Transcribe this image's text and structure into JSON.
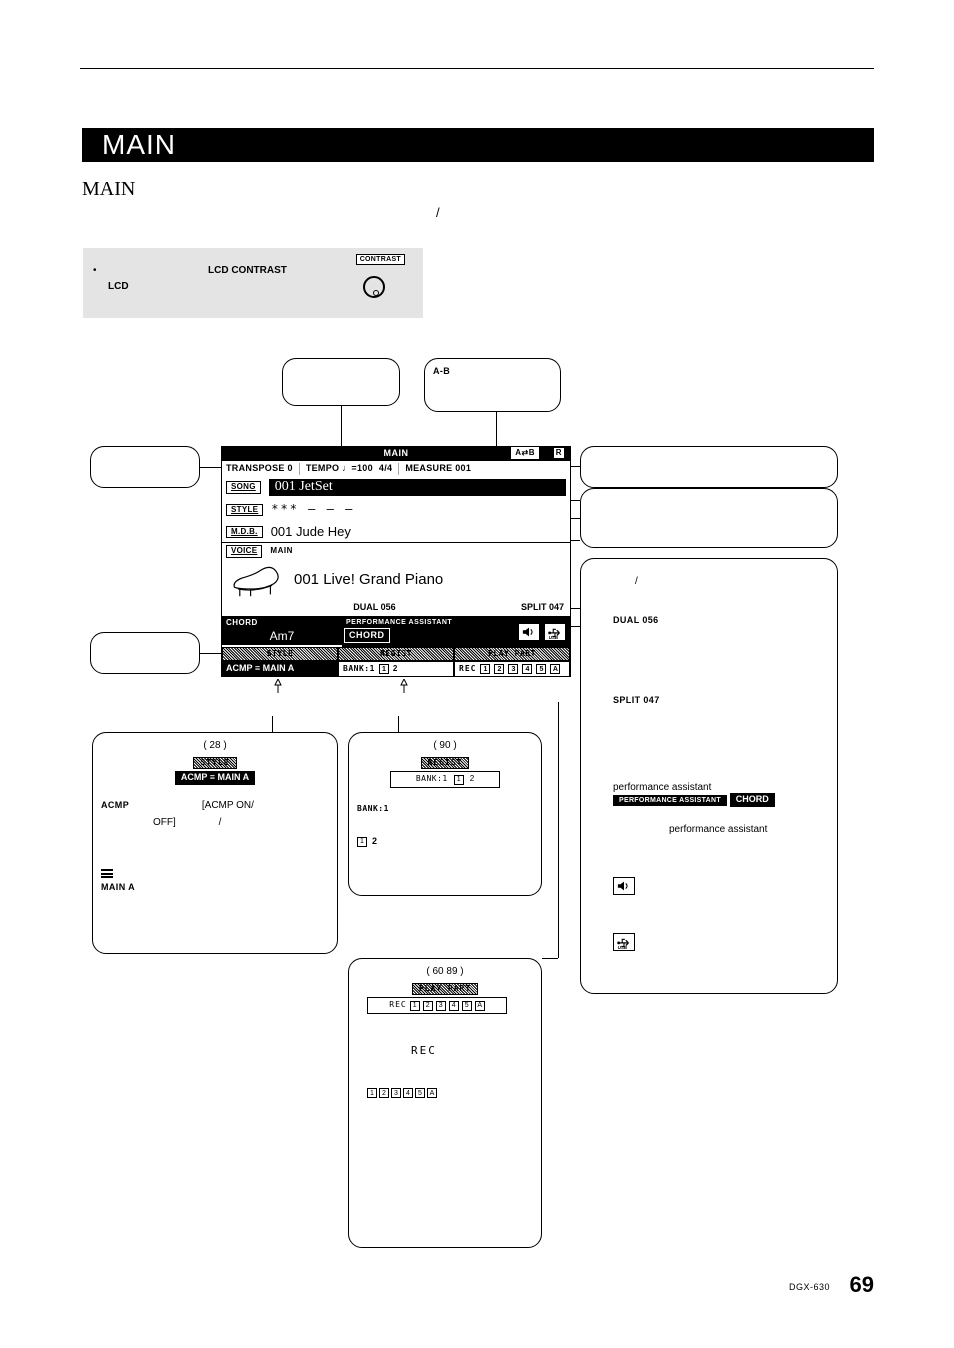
{
  "page": {
    "title_bar": "MAIN",
    "subtitle": "MAIN",
    "slash": "/",
    "model_footer": "DGX-630",
    "page_number": "69"
  },
  "notebox": {
    "star": "•",
    "label_lcd_contrast": "LCD CONTRAST",
    "label_lcd": "LCD",
    "contrast_btn": "CONTRAST"
  },
  "callouts": {
    "ab": "A-B",
    "style_ref": "(   28   )",
    "style_acmp": "ACMP",
    "style_acmp_hint": "[ACMP ON/",
    "style_off": "OFF]",
    "style_slash": "/",
    "style_maina": "MAIN A",
    "regist_ref": "(   90   )",
    "regist_bank": "BANK:1",
    "playpart_ref": "(   60   89   )",
    "rec_label": "REC",
    "dual_slash": "/",
    "dual_label": "DUAL 056",
    "split_label": "SPLIT 047",
    "perf1": "performance assistant",
    "perf_bar_top": "PERFORMANCE ASSISTANT",
    "perf_bar_bot": "CHORD",
    "perf2": "performance assistant"
  },
  "lcd": {
    "header": "MAIN",
    "ab_indicator": "A⇄B",
    "r_box": "R",
    "status": {
      "transpose": "TRANSPOSE  0",
      "tempo": "TEMPO  ♩=100",
      "timesig": "4/4",
      "measure": "MEASURE   001"
    },
    "song": {
      "tag": "SONG",
      "value": "001 JetSet"
    },
    "style": {
      "tag": "STYLE",
      "value": "*** – – –"
    },
    "mdb": {
      "tag": "M.D.B.",
      "value": "001 Jude Hey"
    },
    "voice": {
      "tag": "VOICE",
      "main": "MAIN",
      "value": "001 Live! Grand Piano"
    },
    "dualsplit": {
      "dual": "DUAL 056",
      "split": "SPLIT 047"
    },
    "chord": {
      "label": "CHORD",
      "value": "Am7"
    },
    "perf": {
      "top": "PERFORMANCE ASSISTANT",
      "type": "CHORD"
    },
    "threebar": {
      "style": {
        "title": "STYLE",
        "body": "ACMP ≡ MAIN A"
      },
      "regist": {
        "title": "REGIST",
        "bank": "BANK:1",
        "slots": [
          "1",
          "2"
        ]
      },
      "playpart": {
        "title": "PLAY PART",
        "rec": "REC",
        "tracks": [
          "1",
          "2",
          "3",
          "4",
          "5",
          "A"
        ]
      }
    }
  },
  "frag": {
    "style_title": "STYLE",
    "style_body": "ACMP ≡ MAIN A",
    "regist_title": "REGIST",
    "regist_bank": "BANK:1",
    "regist_slot1": "1",
    "regist_slot2": "2",
    "regist_bank_line": "BANK:1",
    "regist_num2": "2",
    "playpart_title": "PLAY PART",
    "playpart_rec": "REC",
    "playpart_tracks": [
      "1",
      "2",
      "3",
      "4",
      "5",
      "A"
    ]
  }
}
